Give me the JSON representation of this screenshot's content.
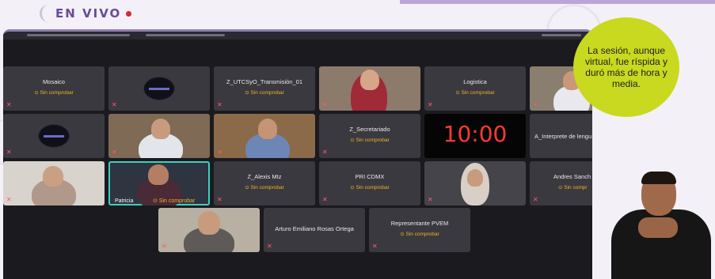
{
  "broadcast": {
    "live_label": "EN VIVO",
    "caption": "La sesión, aunque virtual, fue ríspida y duró más de hora y media.",
    "colors": {
      "live_dot": "#d9263a",
      "bubble": "#c9d91f",
      "accent": "#6a4a98"
    }
  },
  "meeting": {
    "timer": "10:00",
    "status_unverified": "Sin comprobar",
    "participants": [
      {
        "name": "Mosaico",
        "status": "Sin comprobar",
        "kind": "name"
      },
      {
        "name": "",
        "status": "",
        "kind": "logo"
      },
      {
        "name": "Z_UTCSyO_Transmisión_01",
        "status": "Sin comprobar",
        "kind": "name"
      },
      {
        "name": "",
        "status": "",
        "kind": "video"
      },
      {
        "name": "Logistica",
        "status": "Sin comprobar",
        "kind": "name"
      },
      {
        "name": "",
        "status": "",
        "kind": "video"
      },
      {
        "name": "",
        "status": "",
        "kind": "logo"
      },
      {
        "name": "",
        "status": "",
        "kind": "video"
      },
      {
        "name": "",
        "status": "",
        "kind": "video"
      },
      {
        "name": "Z_Secretariado",
        "status": "Sin comprobar",
        "kind": "name"
      },
      {
        "name": "10:00",
        "status": "",
        "kind": "timer"
      },
      {
        "name": "A_Interprete de lengu",
        "status": "",
        "kind": "name"
      },
      {
        "name": "",
        "status": "",
        "kind": "video"
      },
      {
        "name": "Patricia",
        "status": "Sin comprobar",
        "kind": "video-speaking"
      },
      {
        "name": "Z_Alexis Mtz",
        "status": "Sin comprobar",
        "kind": "name"
      },
      {
        "name": "PRI CDMX",
        "status": "Sin comprobar",
        "kind": "name"
      },
      {
        "name": "",
        "status": "",
        "kind": "video"
      },
      {
        "name": "Andres Sanch",
        "status": "Sin compr",
        "kind": "name"
      },
      {
        "name": "",
        "status": "",
        "kind": "video"
      },
      {
        "name": "Arturo Emiliano Rosas Ortega",
        "status": "",
        "kind": "name"
      },
      {
        "name": "Representante PVEM",
        "status": "Sin comprobar",
        "kind": "name"
      }
    ]
  }
}
